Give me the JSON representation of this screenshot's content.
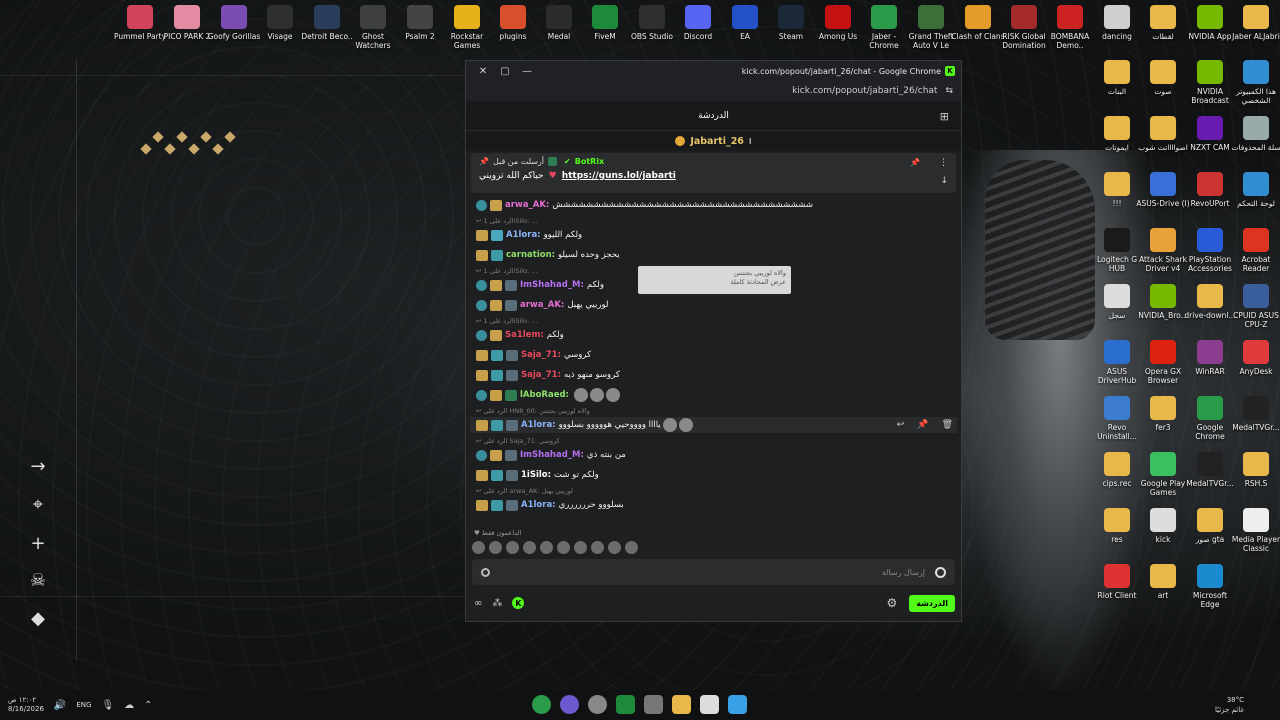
{
  "desktop": {
    "top_icons": [
      {
        "label": "Pummel Party",
        "color": "#d1455a"
      },
      {
        "label": "PICO PARK 2",
        "color": "#e58aa3"
      },
      {
        "label": "Goofy Gorillas",
        "color": "#7a4db3"
      },
      {
        "label": "Visage",
        "color": "#2d2f30"
      },
      {
        "label": "Detroit Beco..",
        "color": "#2a3d5a"
      },
      {
        "label": "Ghost Watchers",
        "color": "#3d3f41"
      },
      {
        "label": "Psalm 2",
        "color": "#444"
      },
      {
        "label": "Rockstar Games",
        "color": "#e6b21a"
      },
      {
        "label": "plugins",
        "color": "#d94f2b"
      },
      {
        "label": "Medal",
        "color": "#2a2b2c"
      },
      {
        "label": "FiveM",
        "color": "#1c8a3a"
      },
      {
        "label": "OBS Studio",
        "color": "#302e31"
      },
      {
        "label": "Discord",
        "color": "#5865f2"
      },
      {
        "label": "EA",
        "color": "#2451c7"
      },
      {
        "label": "Steam",
        "color": "#1b2838"
      },
      {
        "label": "Among Us",
        "color": "#c51111"
      },
      {
        "label": "Jaber - Chrome",
        "color": "#2a9c49"
      },
      {
        "label": "Grand Theft Auto V Le",
        "color": "#3c6e3a"
      },
      {
        "label": "Clash of Clans",
        "color": "#e39b2a"
      },
      {
        "label": "RISK Global Domination",
        "color": "#a52a2a"
      },
      {
        "label": "BOMBANA Demo..",
        "color": "#c22"
      },
      {
        "label": "dancing",
        "color": "#cfcfcf"
      },
      {
        "label": "لقطات",
        "color": "#e8b84a"
      },
      {
        "label": "NVIDIA App",
        "color": "#76b900"
      },
      {
        "label": "Jaber ALJabri",
        "color": "#e8b84a"
      }
    ],
    "right_icons": [
      {
        "label": "البنات",
        "color": "#e8b84a"
      },
      {
        "label": "صوت",
        "color": "#e8b84a"
      },
      {
        "label": "NVIDIA Broadcast",
        "color": "#76b900"
      },
      {
        "label": "هذا الكمبيوتر الشخصي",
        "color": "#2f8fd0"
      },
      {
        "label": "ايموتات",
        "color": "#e8b84a"
      },
      {
        "label": "اصوااااتت شوب",
        "color": "#e8b84a"
      },
      {
        "label": "NZXT CAM",
        "color": "#6a1bb0"
      },
      {
        "label": "سلة المحذوفات",
        "color": "#9aa"
      },
      {
        "label": "!!!",
        "color": "#e8b84a"
      },
      {
        "label": "ASUS-Drive (I)",
        "color": "#3a6fd8"
      },
      {
        "label": "RevoUPort",
        "color": "#c33"
      },
      {
        "label": "لوحة التحكم",
        "color": "#2f8fd0"
      },
      {
        "label": "Logitech G HUB",
        "color": "#1a1a1a"
      },
      {
        "label": "Attack Shark Driver v4",
        "color": "#e8a23a"
      },
      {
        "label": "PlayStation Accessories",
        "color": "#2a5bd7"
      },
      {
        "label": "Acrobat Reader",
        "color": "#d32"
      },
      {
        "label": "سجل",
        "color": "#ddd"
      },
      {
        "label": "NVIDIA_Bro...",
        "color": "#76b900"
      },
      {
        "label": "drive-downl...",
        "color": "#e8b84a"
      },
      {
        "label": "CPUID ASUS CPU-Z",
        "color": "#3a5d9c"
      },
      {
        "label": "ASUS DriverHub",
        "color": "#2a6fd0"
      },
      {
        "label": "Opera GX Browser",
        "color": "#d21"
      },
      {
        "label": "WinRAR",
        "color": "#8b3d8f"
      },
      {
        "label": "AnyDesk",
        "color": "#e03a3a"
      },
      {
        "label": "Revo Uninstall...",
        "color": "#3c7cd0"
      },
      {
        "label": "fer3",
        "color": "#e8b84a"
      },
      {
        "label": "Google Chrome",
        "color": "#2a9c49"
      },
      {
        "label": "MedalTVGr...",
        "color": "#222"
      },
      {
        "label": "cips.rec",
        "color": "#e8b84a"
      },
      {
        "label": "Google Play Games",
        "color": "#3ac060"
      },
      {
        "label": "MedalTVGr...",
        "color": "#222"
      },
      {
        "label": "RSH.S",
        "color": "#e8b84a"
      },
      {
        "label": "res",
        "color": "#e8b84a"
      },
      {
        "label": "kick",
        "color": "#ddd"
      },
      {
        "label": "صور gta",
        "color": "#e8b84a"
      },
      {
        "label": "Media Player Classic",
        "color": "#eee"
      },
      {
        "label": "Riot Client",
        "color": "#d33"
      },
      {
        "label": "art",
        "color": "#e8b84a"
      },
      {
        "label": "Microsoft Edge",
        "color": "#1b8bd0"
      }
    ]
  },
  "window": {
    "title": "kick.com/popout/jabarti_26/chat - Google Chrome",
    "url": "kick.com/popout/jabarti_26/chat",
    "chat_header": "الدردشة",
    "streamer": "Jabarti_26",
    "pinned": {
      "by_label": "أرسلت من قبل",
      "bot_name": "BotRix",
      "text": "حياكم الله ترويني",
      "link": "https://guns.lol/jabarti"
    },
    "messages": [
      {
        "user": "arwa_AK",
        "color": "#e56fd3",
        "text": "شششششششششششششششششششششششششششششششششش",
        "reply": null
      },
      {
        "user": "A1lora",
        "color": "#8ab4f8",
        "text": "ولكم الليوو",
        "reply": "الرد على 1iSilo: ..."
      },
      {
        "user": "carnation",
        "color": "#8fe06a",
        "text": "بحجز وحده لسيلو",
        "reply": null
      },
      {
        "user": "ImShahad_M",
        "color": "#b56ff0",
        "text": "ولكم",
        "reply": "الرد على 1iSilo: ..."
      },
      {
        "user": "arwa_AK",
        "color": "#e56fd3",
        "text": "لوربيي يهبل",
        "reply": null
      },
      {
        "user": "Sa1lem",
        "color": "#e8485d",
        "text": "ولكم",
        "reply": "الرد على 1iSilo: ..."
      },
      {
        "user": "Saja_71",
        "color": "#e8485d",
        "text": "كروسي",
        "reply": null
      },
      {
        "user": "Saja_71",
        "color": "#e8485d",
        "text": "كروسو منهو ذيه",
        "reply": null
      },
      {
        "user": "lAboRaed",
        "color": "#8fe06a",
        "text": "",
        "reply": null
      },
      {
        "user": "A1lora",
        "color": "#8ab4f8",
        "text": "ياااا ووووحيي هووووو بسلووو",
        "reply": "الرد على HN8_00: والاه لوربيي بجنننن"
      },
      {
        "user": "ImShahad_M",
        "color": "#b56ff0",
        "text": "من بنته ذي",
        "reply": "الرد على Saja_71: كروسي"
      },
      {
        "user": "1iSilo",
        "color": "#ffffff",
        "text": "ولكم تو شت",
        "reply": null
      },
      {
        "user": "A1lora",
        "color": "#8ab4f8",
        "text": "بسلووو حرررررري",
        "reply": "الرد على arwa_AK: لوربيي يهبل"
      }
    ],
    "tooltip": {
      "line1": "والاه لوربيي بجننننن",
      "line2": "عرض المحادثة كاملة"
    },
    "supporters_label": "الداعمون فقط",
    "input_placeholder": "إرسال رسالة",
    "send_button": "الدردشة"
  },
  "taskbar": {
    "time": "١٢:٠٢ ص",
    "date": "8/16/2026",
    "lang": "ENG",
    "weather_temp": "38°C",
    "weather_desc": "غائم جزئيًا"
  }
}
